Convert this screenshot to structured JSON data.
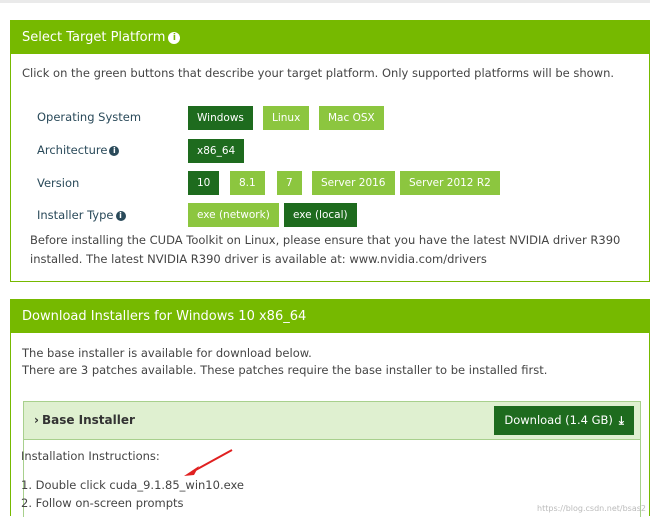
{
  "platform": {
    "title": "Select Target Platform",
    "lead": "Click on the green buttons that describe your target platform. Only supported platforms will be shown.",
    "rows": [
      {
        "label": "Operating System",
        "options": [
          "Windows",
          "Linux",
          "Mac OSX"
        ],
        "selected": "Windows"
      },
      {
        "label": "Architecture",
        "options": [
          "x86_64"
        ],
        "selected": "x86_64"
      },
      {
        "label": "Version",
        "options": [
          "10",
          "8.1",
          "7",
          "Server 2016",
          "Server 2012 R2"
        ],
        "selected": "10"
      },
      {
        "label": "Installer Type",
        "options": [
          "exe (network)",
          "exe (local)"
        ],
        "selected": "exe (local)"
      }
    ],
    "note_line1": "Before installing the CUDA Toolkit on Linux, please ensure that you have the latest NVIDIA driver R390",
    "note_line2": "installed. The latest NVIDIA R390 driver is available at: www.nvidia.com/drivers"
  },
  "download": {
    "title": "Download Installers for Windows 10 x86_64",
    "line1": "The base installer is available for download below.",
    "line2": "There are 3 patches available. These patches require the base installer to be installed first.",
    "base_title": "Base Installer",
    "button_label": "Download (1.4 GB)",
    "instructions_title": "Installation Instructions:",
    "steps": [
      "1. Double click cuda_9.1.85_win10.exe",
      "2. Follow on-screen prompts"
    ]
  },
  "icons": {
    "info": "info-icon",
    "chevron": "chevron-right-icon",
    "download": "download-icon",
    "annotation": "red-arrow-annotation"
  },
  "colors": {
    "brand_green": "#76b900",
    "selected_green": "#1e6b1e",
    "option_green": "#8cc63f",
    "annotation_red": "#e02020"
  },
  "watermark": "https://blog.csdn.net/bsas2"
}
